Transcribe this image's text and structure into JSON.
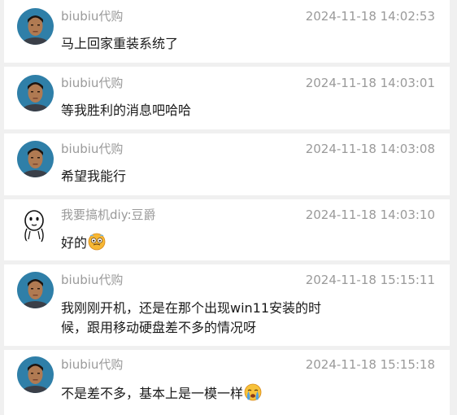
{
  "messages": [
    {
      "user": "biubiu代购",
      "time": "2024-11-18 14:02:53",
      "text": "马上回家重装系统了",
      "avatar": "person-photo-avatar"
    },
    {
      "user": "biubiu代购",
      "time": "2024-11-18 14:03:01",
      "text": "等我胜利的消息吧哈哈",
      "avatar": "person-photo-avatar"
    },
    {
      "user": "biubiu代购",
      "time": "2024-11-18 14:03:08",
      "text": "希望我能行",
      "avatar": "person-photo-avatar"
    },
    {
      "user": "我要搞机diy:豆爵",
      "time": "2024-11-18 14:03:10",
      "text": "好的",
      "avatar": "doodle-face-avatar",
      "emoji": "hot-face-emoji"
    },
    {
      "user": "biubiu代购",
      "time": "2024-11-18 15:15:11",
      "text_line1": "我刚刚开机，还是在那个出现win11安装的时",
      "text_line2": "候，跟用移动硬盘差不多的情况呀",
      "avatar": "person-photo-avatar"
    },
    {
      "user": "biubiu代购",
      "time": "2024-11-18 15:15:18",
      "text": "不是差不多，基本上是一模一样",
      "avatar": "person-photo-avatar",
      "emoji": "crying-face-emoji"
    }
  ],
  "colors": {
    "background": "#f0f0f0",
    "card": "#ffffff",
    "meta_text": "#9a9a9a",
    "body_text": "#1a1a1a"
  }
}
